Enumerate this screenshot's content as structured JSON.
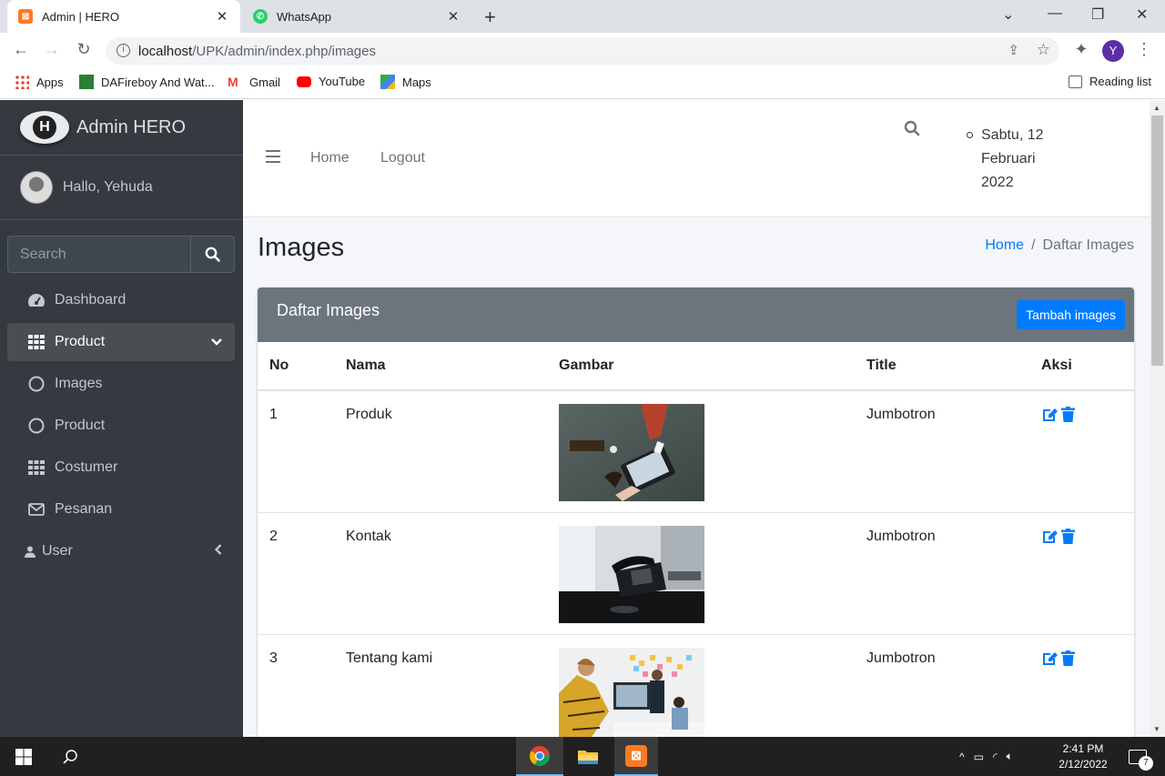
{
  "browser": {
    "tabs": [
      {
        "title": "Admin | HERO",
        "favicon_color": "#fb7a24"
      },
      {
        "title": "WhatsApp",
        "favicon_color": "#25d366"
      }
    ],
    "url_host": "localhost",
    "url_path": "/UPK/admin/index.php/images",
    "profile_initial": "Y",
    "bookmarks": [
      "Apps",
      "DAFireboy And Wat...",
      "Gmail",
      "YouTube",
      "Maps"
    ],
    "reading_list": "Reading list"
  },
  "sidebar": {
    "brand": "Admin HERO",
    "brand_letter": "H",
    "user": "Hallo, Yehuda",
    "search_placeholder": "Search",
    "items": [
      {
        "label": "Dashboard",
        "icon": "dashboard-icon"
      },
      {
        "label": "Product",
        "icon": "grid-icon",
        "active": true
      },
      {
        "label": "Images",
        "icon": "circle-icon"
      },
      {
        "label": "Product",
        "icon": "circle-icon"
      },
      {
        "label": "Costumer",
        "icon": "grid-icon"
      },
      {
        "label": "Pesanan",
        "icon": "envelope-icon"
      },
      {
        "label": "User",
        "icon": "user-icon"
      }
    ]
  },
  "topnav": {
    "home": "Home",
    "logout": "Logout",
    "date_line1": "Sabtu, 12",
    "date_line2": "Februari",
    "date_line3": "2022"
  },
  "content": {
    "title": "Images",
    "breadcrumb_home": "Home",
    "breadcrumb_sep": "/",
    "breadcrumb_current": "Daftar Images",
    "card_title": "Daftar Images",
    "add_button": "Tambah images",
    "columns": [
      "No",
      "Nama",
      "Gambar",
      "Title",
      "Aksi"
    ],
    "rows": [
      {
        "no": "1",
        "nama": "Produk",
        "title": "Jumbotron",
        "image": "photo-hands-tablet"
      },
      {
        "no": "2",
        "nama": "Kontak",
        "title": "Jumbotron",
        "image": "photo-office-phone"
      },
      {
        "no": "3",
        "nama": "Tentang kami",
        "title": "Jumbotron",
        "image": "photo-team-meeting"
      }
    ]
  },
  "taskbar": {
    "time": "2:41 PM",
    "date": "2/12/2022",
    "notifications": "7"
  },
  "colors": {
    "sidebar_bg": "#343a40",
    "card_header": "#6c757d",
    "primary": "#007bff",
    "content_bg": "#f4f6f9"
  }
}
